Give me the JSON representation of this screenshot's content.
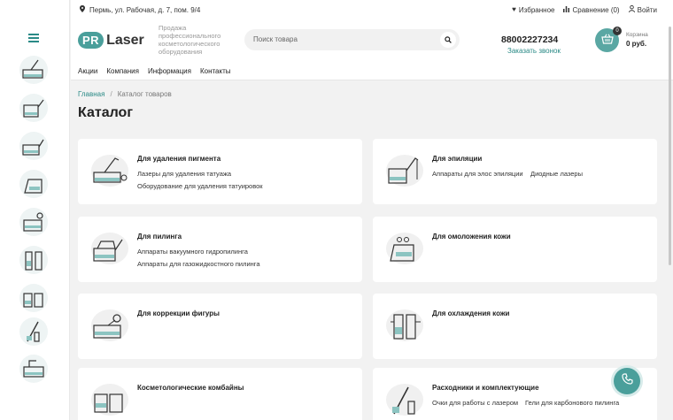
{
  "topbar": {
    "address": "Пермь, ул. Рабочая, д. 7, пом. 9/4",
    "favorites": "Избранное",
    "compare": "Сравнение (0)",
    "login": "Войти"
  },
  "header": {
    "logo_pr": "PR",
    "logo_laser": "Laser",
    "tagline": "Продажа профессионального косметологического оборудования",
    "search_placeholder": "Поиск товара",
    "phone": "88002227234",
    "callback": "Заказать звонок",
    "cart_count": "0",
    "cart_label": "Корзина",
    "cart_sum": "0 руб."
  },
  "nav": [
    "Акции",
    "Компания",
    "Информация",
    "Контакты"
  ],
  "breadcrumb": {
    "home": "Главная",
    "separator": "/",
    "current": "Каталог товаров"
  },
  "page_title": "Каталог",
  "categories": [
    {
      "title": "Для удаления пигмента",
      "subs": [
        "Лазеры для удаления татуажа",
        "Оборудование для удаления татуировок"
      ]
    },
    {
      "title": "Для эпиляции",
      "subs": [
        "Аппараты для элос эпиляции",
        "Диодные лазеры"
      ]
    },
    {
      "title": "Для пилинга",
      "subs": [
        "Аппараты вакуумного гидропилинга",
        "Аппараты для газожидкостного пилинга"
      ]
    },
    {
      "title": "Для омоложения кожи",
      "subs": []
    },
    {
      "title": "Для коррекции фигуры",
      "subs": []
    },
    {
      "title": "Для охлаждения кожи",
      "subs": []
    },
    {
      "title": "Косметологические комбайны",
      "subs": []
    },
    {
      "title": "Расходники и комплектующие",
      "subs": [
        "Очки для работы с лазером",
        "Гели для карбонового пилинга"
      ]
    }
  ],
  "colors": {
    "accent": "#4a9f9b",
    "link": "#2a8a86"
  }
}
